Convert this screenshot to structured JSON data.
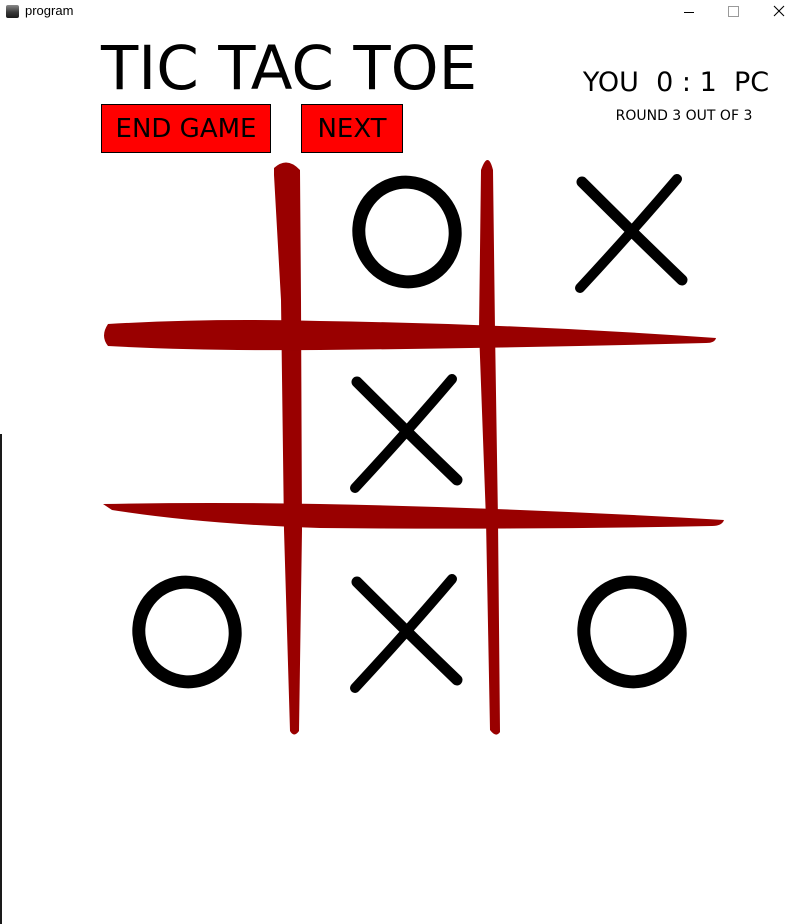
{
  "window": {
    "title": "program",
    "minimize_icon": "minimize-icon",
    "maximize_icon": "maximize-icon",
    "close_icon": "close-icon"
  },
  "game": {
    "title": "TIC TAC TOE",
    "end_game_label": "END GAME",
    "next_label": "NEXT",
    "score": {
      "you_label": "YOU",
      "you_score": "0",
      "separator": ":",
      "pc_score": "1",
      "pc_label": "PC"
    },
    "round_text": "ROUND 3 OUT OF 3"
  },
  "board": {
    "cells": [
      [
        "",
        "O",
        "X"
      ],
      [
        "",
        "X",
        ""
      ],
      [
        "O",
        "X",
        "O"
      ]
    ]
  },
  "colors": {
    "button_bg": "#ff0000",
    "grid_line": "#990000",
    "mark": "#000000"
  }
}
